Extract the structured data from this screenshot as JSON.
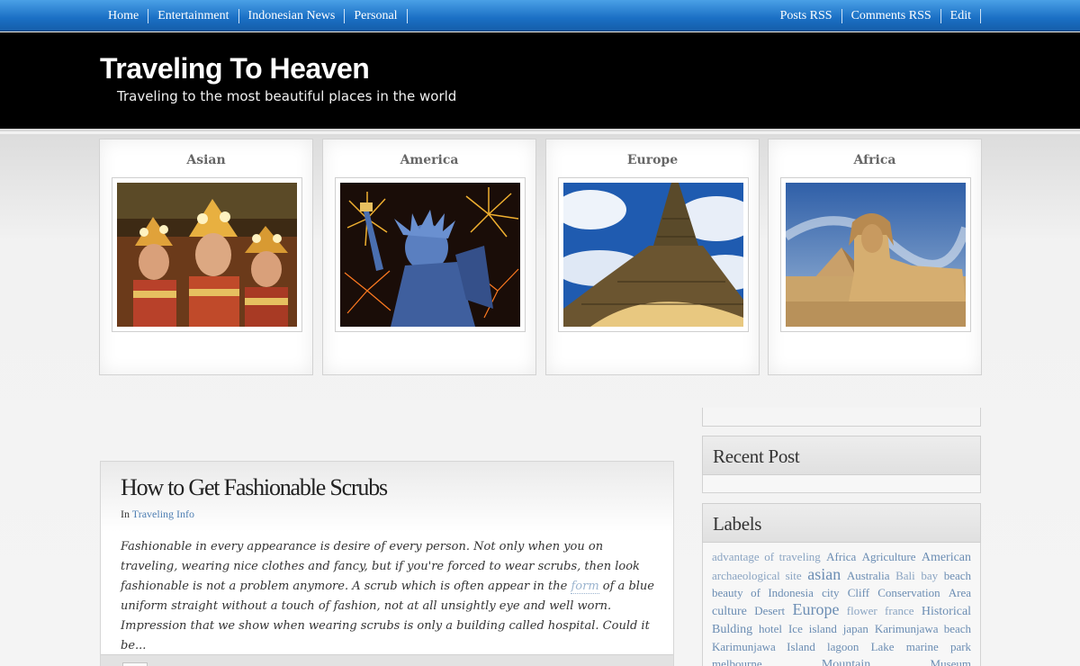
{
  "nav": {
    "left": [
      "Home",
      "Entertainment",
      "Indonesian News",
      "Personal"
    ],
    "right": [
      "Posts RSS",
      "Comments RSS",
      "Edit"
    ]
  },
  "site": {
    "title": "Traveling To Heaven",
    "tagline": "Traveling to the most beautiful places in the world"
  },
  "featured": [
    {
      "title": "Asian",
      "image": "balinese-dancers-photo"
    },
    {
      "title": "America",
      "image": "statue-of-liberty-fireworks-photo"
    },
    {
      "title": "Europe",
      "image": "eiffel-tower-photo"
    },
    {
      "title": "Africa",
      "image": "sphinx-pyramid-photo"
    }
  ],
  "post": {
    "title": "How to Get Fashionable Scrubs",
    "meta_prefix": "In",
    "category": "Traveling Info",
    "excerpt_before": "Fashionable in every appearance is desire of every person. Not only when you on traveling, wearing nice clothes and fancy, but if you're forced to wear scrubs, then look fashionable is not a problem anymore. A scrub which is often appear in the ",
    "excerpt_link": "form",
    "excerpt_after": " of a blue uniform straight without a touch of fashion, not at all unsightly eye and well worn. Impression that we show when wearing scrubs is only a building called hospital. Could it be..."
  },
  "sidebar": {
    "recent_title": "Recent Post",
    "labels_title": "Labels",
    "labels": [
      {
        "text": "advantage of traveling",
        "size": 1
      },
      {
        "text": "Africa",
        "size": 2
      },
      {
        "text": "Agriculture",
        "size": 2
      },
      {
        "text": "American",
        "size": 3
      },
      {
        "text": "archaeological site",
        "size": 1
      },
      {
        "text": "asian",
        "size": 5
      },
      {
        "text": "Australia",
        "size": 2
      },
      {
        "text": "Bali",
        "size": 1
      },
      {
        "text": "bay",
        "size": 1
      },
      {
        "text": "beach",
        "size": 2
      },
      {
        "text": "beauty of Indonesia",
        "size": 2
      },
      {
        "text": "city",
        "size": 2
      },
      {
        "text": "Cliff",
        "size": 2
      },
      {
        "text": "Conservation",
        "size": 2
      },
      {
        "text": "Area",
        "size": 2
      },
      {
        "text": "culture",
        "size": 3
      },
      {
        "text": "Desert",
        "size": 2
      },
      {
        "text": "Europe",
        "size": 5
      },
      {
        "text": "flower",
        "size": 1
      },
      {
        "text": "france",
        "size": 1
      },
      {
        "text": "Historical Bulding",
        "size": 3
      },
      {
        "text": "hotel",
        "size": 2
      },
      {
        "text": "Ice",
        "size": 2
      },
      {
        "text": "island",
        "size": 2
      },
      {
        "text": "japan",
        "size": 2
      },
      {
        "text": "Karimunjawa beach",
        "size": 2
      },
      {
        "text": "Karimunjawa Island",
        "size": 2
      },
      {
        "text": "lagoon",
        "size": 2
      },
      {
        "text": "Lake",
        "size": 2
      },
      {
        "text": "marine",
        "size": 2
      },
      {
        "text": "park",
        "size": 2
      },
      {
        "text": "melbourne",
        "size": 2
      },
      {
        "text": "Mountain",
        "size": 3
      },
      {
        "text": "Museum",
        "size": 2
      }
    ]
  },
  "colors": {
    "nav_blue": "#1a6fc4",
    "header_bg": "#000000",
    "link": "#4f7fb3",
    "tag": "#6b8db3"
  }
}
